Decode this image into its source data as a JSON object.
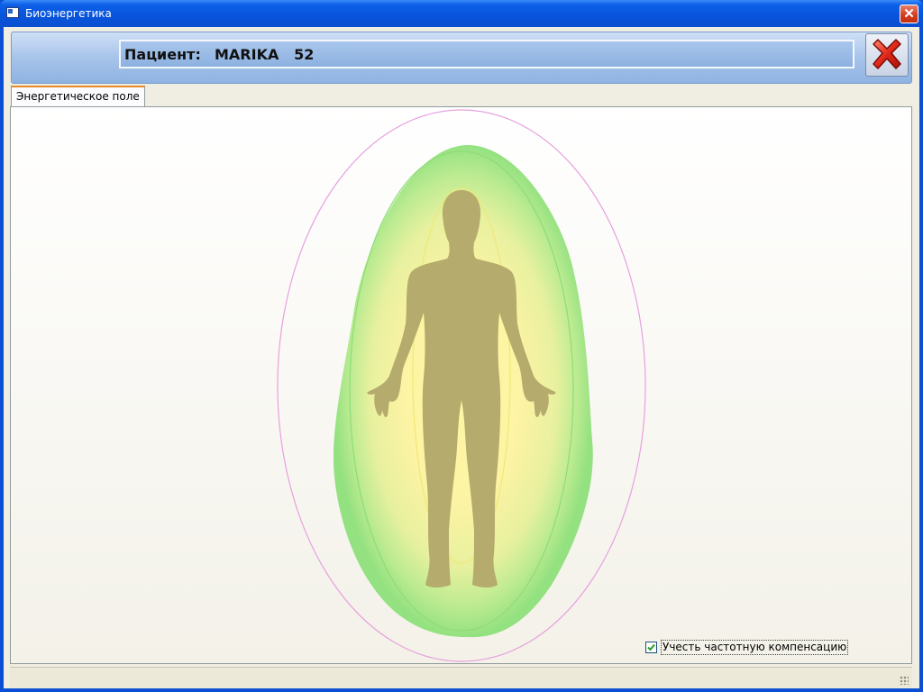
{
  "window": {
    "title": "Биоэнергетика",
    "close_glyph": "✕"
  },
  "header": {
    "patient_label": "Пациент:",
    "patient_name": "MARIKA",
    "patient_age": "52",
    "exit_icon": "red-x-icon"
  },
  "tabs": [
    {
      "label": "Энергетическое поле",
      "active": true
    }
  ],
  "energy_field": {
    "aura_colors": {
      "outer": "#e8a0e0",
      "green": "#8ee07a",
      "yellow": "#fff6a0",
      "body": "#b5ab6c"
    }
  },
  "options": {
    "frequency_compensation_label": "Учесть частотную компенсацию",
    "frequency_compensation_checked": true,
    "check_glyph": "✓"
  }
}
